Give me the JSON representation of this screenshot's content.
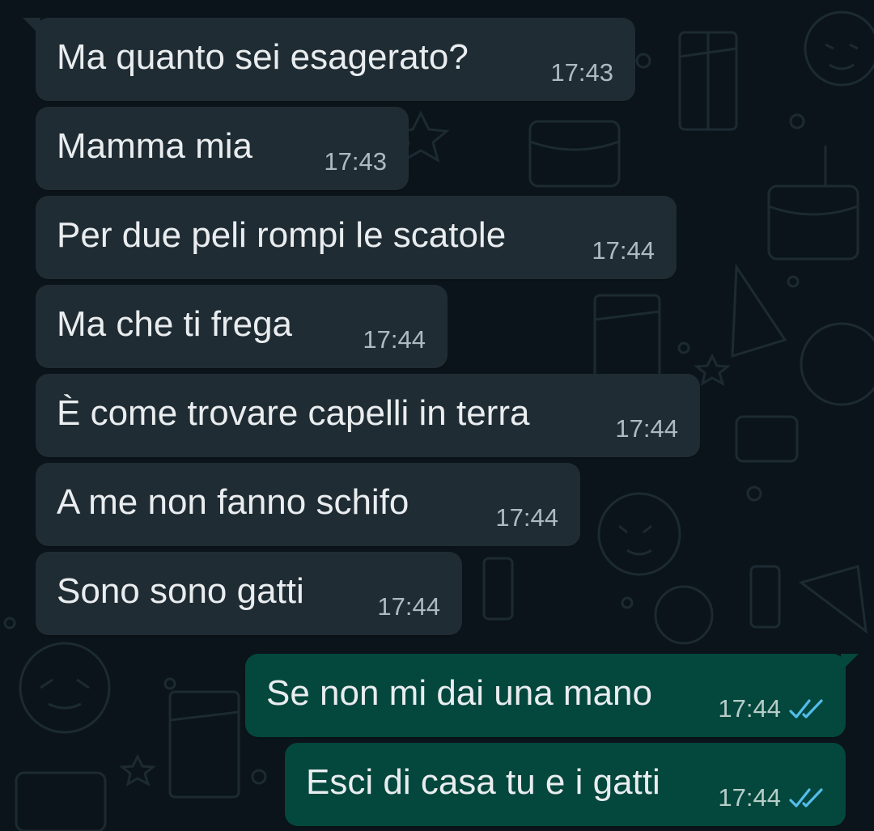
{
  "colors": {
    "background": "#0b141a",
    "incoming_bubble": "#202c33",
    "outgoing_bubble": "#04473d",
    "text": "#e9edef",
    "timestamp": "#aebac1",
    "read_ticks": "#53bdeb"
  },
  "messages": [
    {
      "direction": "incoming",
      "text": "Ma quanto sei esagerato?",
      "time": "17:43"
    },
    {
      "direction": "incoming",
      "text": "Mamma mia",
      "time": "17:43"
    },
    {
      "direction": "incoming",
      "text": "Per due peli rompi le scatole",
      "time": "17:44"
    },
    {
      "direction": "incoming",
      "text": "Ma che ti frega",
      "time": "17:44"
    },
    {
      "direction": "incoming",
      "text": "È come trovare capelli in terra",
      "time": "17:44"
    },
    {
      "direction": "incoming",
      "text": "A me non fanno schifo",
      "time": "17:44"
    },
    {
      "direction": "incoming",
      "text": "Sono sono gatti",
      "time": "17:44"
    },
    {
      "direction": "outgoing",
      "text": "Se non mi dai una mano",
      "time": "17:44",
      "status_icon": "double-check-read-icon"
    },
    {
      "direction": "outgoing",
      "text": "Esci di casa tu e i gatti",
      "time": "17:44",
      "status_icon": "double-check-read-icon"
    }
  ]
}
